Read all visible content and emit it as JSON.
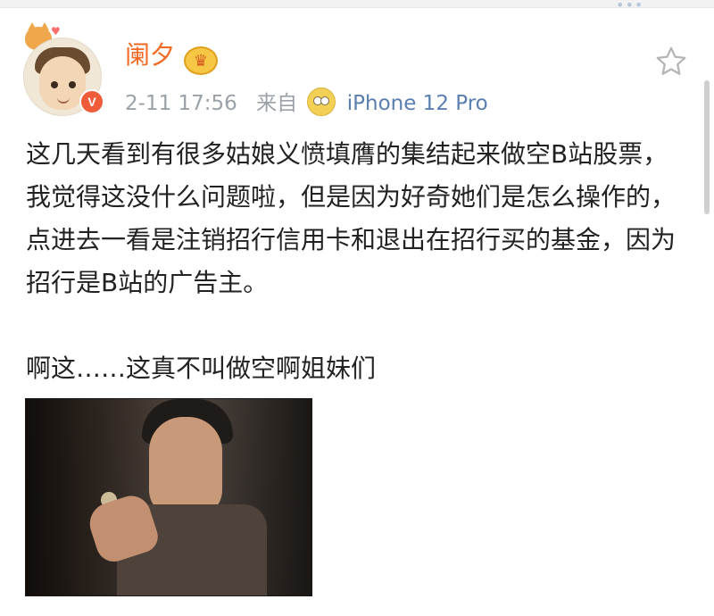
{
  "post": {
    "username": "阑夕",
    "time": "2-11 17:56",
    "source_label": "来自",
    "device": "iPhone 12 Pro",
    "text_line1": "这几天看到有很多姑娘义愤填膺的集结起来做空B站股票，我觉得这没什么问题啦，但是因为好奇她们是怎么操作的，点进去一看是注销招行信用卡和退出在招行买的基金，因为招行是B站的广告主。",
    "text_line2": "啊这……这真不叫做空啊姐妹们",
    "verified_mark": "V"
  },
  "icons": {
    "top_more": "more-icon",
    "star": "star-icon",
    "crown": "crown-icon",
    "emoji": "emoji-icon"
  },
  "colors": {
    "username": "#f26a22",
    "meta": "#9aa1a8",
    "device": "#5a7fae",
    "verified": "#f05b3a"
  }
}
